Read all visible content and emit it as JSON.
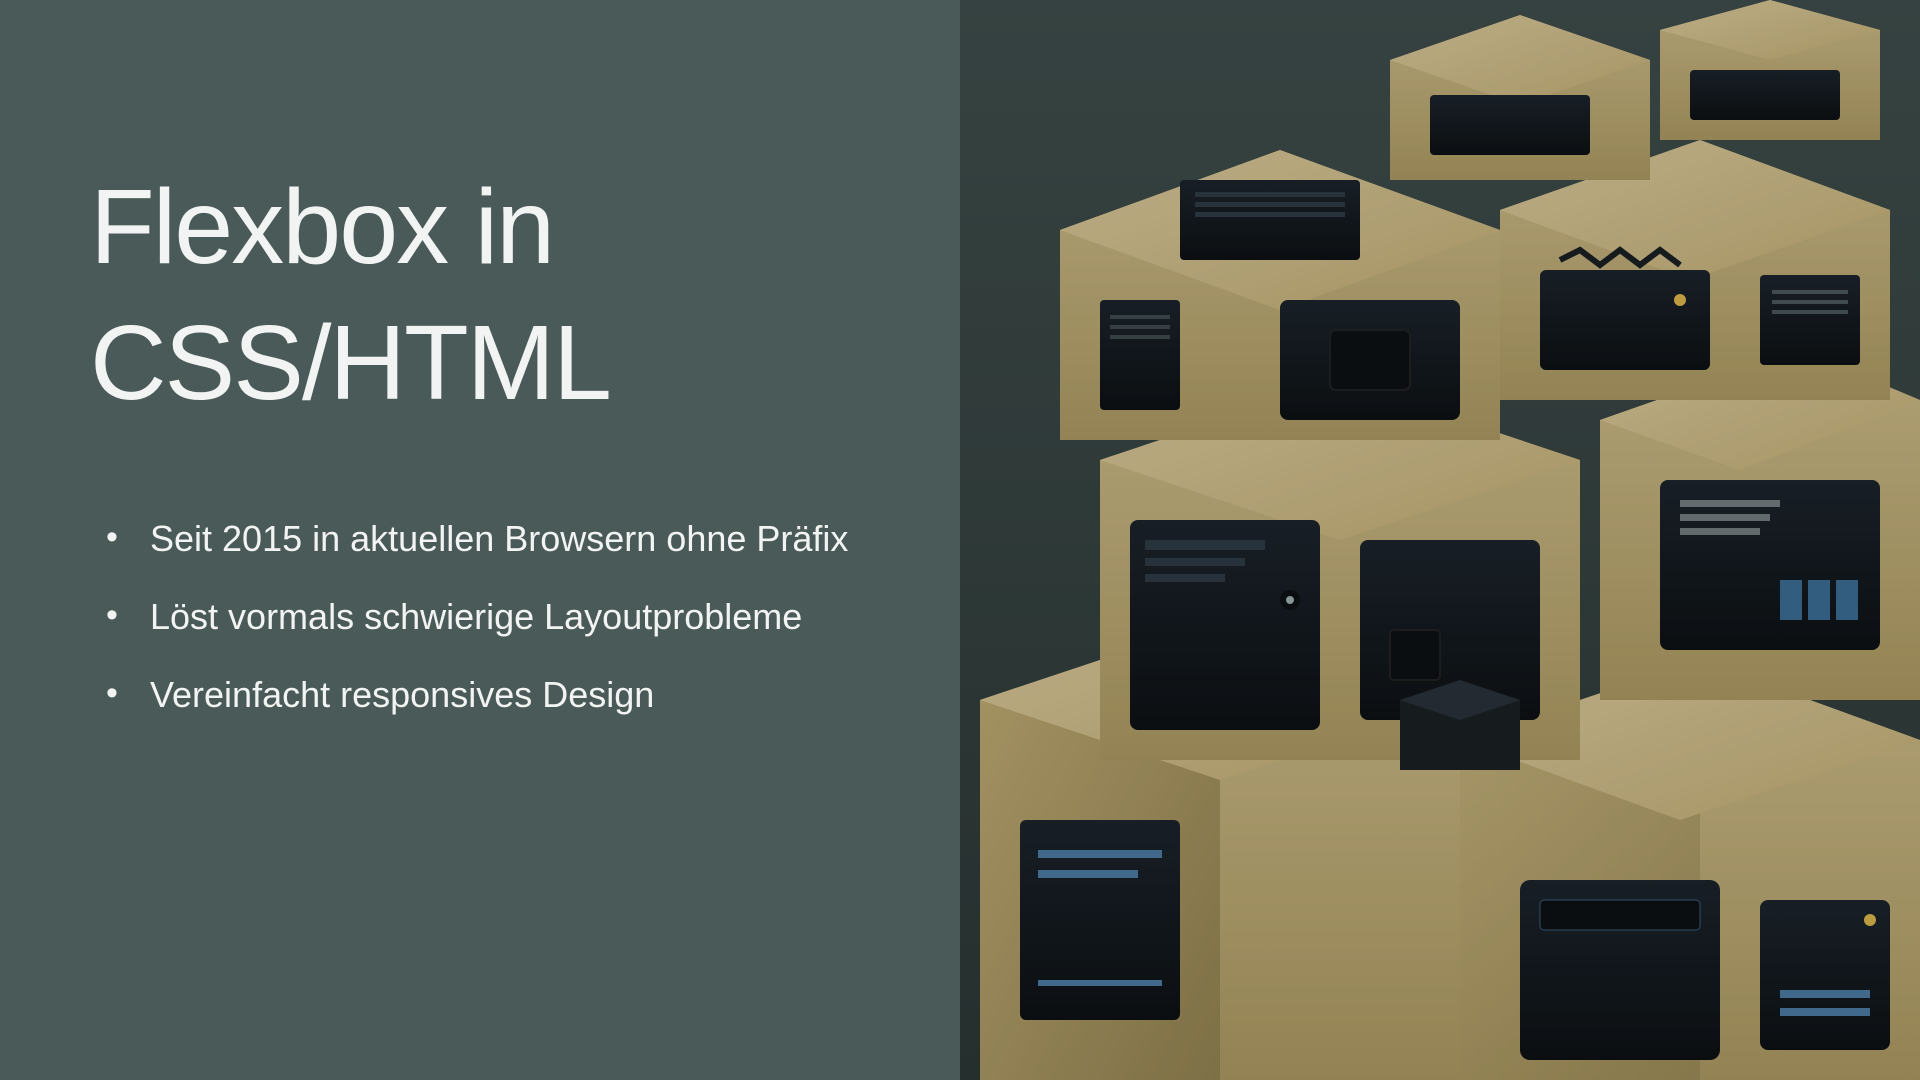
{
  "slide": {
    "title": "Flexbox in CSS/HTML",
    "bullets": [
      "Seit 2015 in aktuellen Browsern ohne Präfix",
      "Löst vormals schwierige Layoutprobleme",
      "Vereinfacht responsives Design"
    ],
    "image_alt": "stacked-tech-boxes-illustration"
  },
  "colors": {
    "bg_left": "#4a5a58",
    "bg_right": "#3a4645",
    "text": "#f2f4f3",
    "box_light": "#c9b887",
    "box_dark": "#1a1f23",
    "accent_blue": "#5a8cb5",
    "accent_yellow": "#d8b24a"
  }
}
